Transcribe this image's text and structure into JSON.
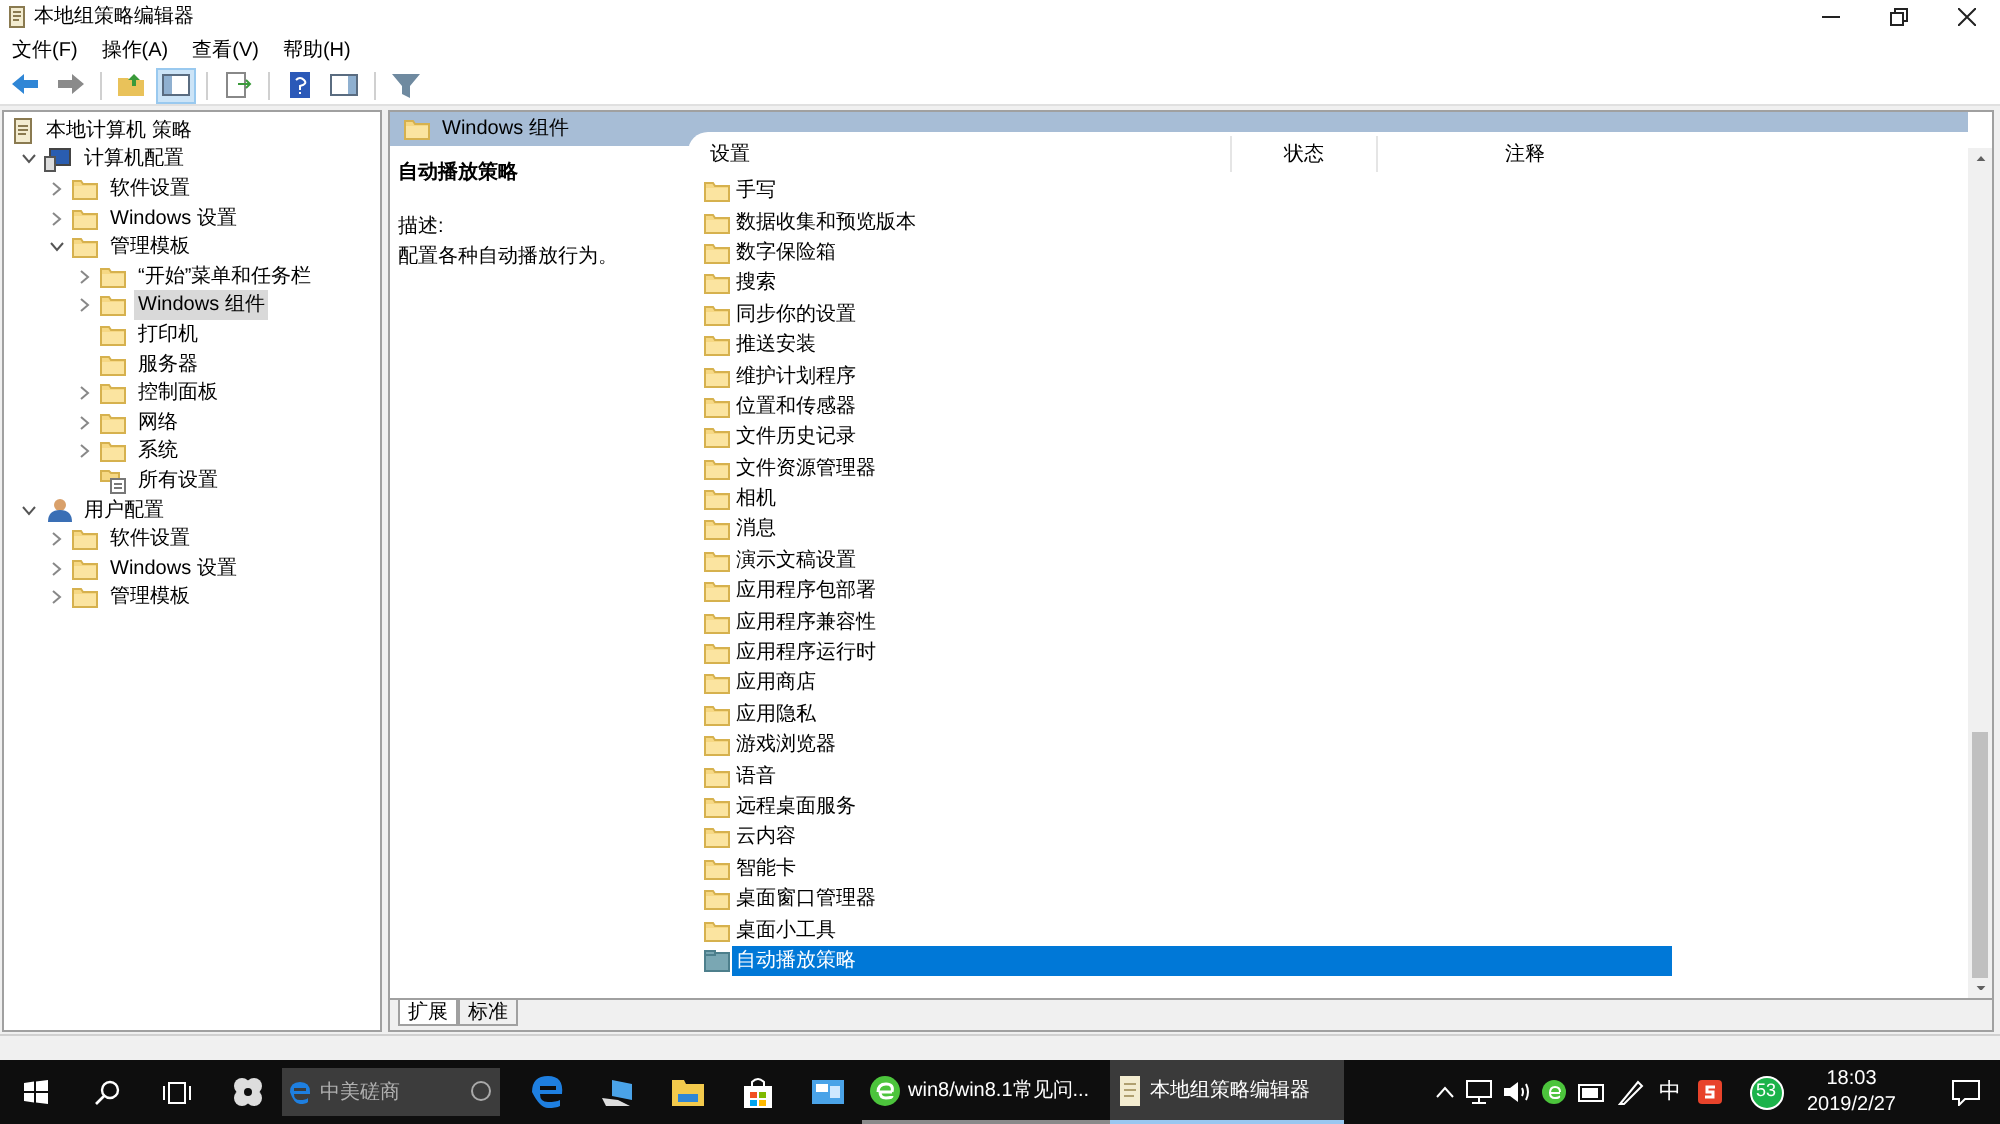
{
  "window": {
    "title": "本地组策略编辑器"
  },
  "menu": [
    "文件(F)",
    "操作(A)",
    "查看(V)",
    "帮助(H)"
  ],
  "toolbar": [
    {
      "kind": "back",
      "on": false
    },
    {
      "kind": "forward",
      "on": false
    },
    {
      "kind": "sep"
    },
    {
      "kind": "up",
      "on": false
    },
    {
      "kind": "tree",
      "on": true
    },
    {
      "kind": "sep"
    },
    {
      "kind": "export",
      "on": false
    },
    {
      "kind": "sep"
    },
    {
      "kind": "help",
      "on": false
    },
    {
      "kind": "pane",
      "on": false
    },
    {
      "kind": "sep"
    },
    {
      "kind": "filter",
      "on": false
    }
  ],
  "tree": [
    {
      "label": "本地计算机 策略",
      "kind": "policy",
      "selected": false,
      "children": [
        {
          "label": "计算机配置",
          "kind": "computer",
          "expanded": true,
          "selected": false,
          "children": [
            {
              "label": "软件设置",
              "kind": "folder",
              "expanded": false,
              "selected": false
            },
            {
              "label": "Windows 设置",
              "kind": "folder",
              "expanded": false,
              "selected": false
            },
            {
              "label": "管理模板",
              "kind": "folder",
              "expanded": true,
              "selected": false,
              "children": [
                {
                  "label": "“开始”菜单和任务栏",
                  "kind": "folder",
                  "expanded": false,
                  "selected": false
                },
                {
                  "label": "Windows 组件",
                  "kind": "folder",
                  "expanded": false,
                  "selected": true
                },
                {
                  "label": "打印机",
                  "kind": "folder",
                  "selected": false
                },
                {
                  "label": "服务器",
                  "kind": "folder",
                  "selected": false
                },
                {
                  "label": "控制面板",
                  "kind": "folder",
                  "expanded": false,
                  "selected": false
                },
                {
                  "label": "网络",
                  "kind": "folder",
                  "expanded": false,
                  "selected": false
                },
                {
                  "label": "系统",
                  "kind": "folder",
                  "expanded": false,
                  "selected": false
                },
                {
                  "label": "所有设置",
                  "kind": "settings",
                  "selected": false
                }
              ]
            }
          ]
        },
        {
          "label": "用户配置",
          "kind": "user",
          "expanded": true,
          "selected": false,
          "children": [
            {
              "label": "软件设置",
              "kind": "folder",
              "expanded": false,
              "selected": false
            },
            {
              "label": "Windows 设置",
              "kind": "folder",
              "expanded": false,
              "selected": false
            },
            {
              "label": "管理模板",
              "kind": "folder",
              "expanded": false,
              "selected": false
            }
          ]
        }
      ]
    }
  ],
  "pane_header": "Windows 组件",
  "description": {
    "title": "自动播放策略",
    "label": "描述:",
    "text": "配置各种自动播放行为。"
  },
  "columns": [
    "设置",
    "状态",
    "注释"
  ],
  "items": [
    {
      "label": "手写",
      "kind": "folder",
      "selected": false
    },
    {
      "label": "数据收集和预览版本",
      "kind": "folder",
      "selected": false
    },
    {
      "label": "数字保险箱",
      "kind": "folder",
      "selected": false
    },
    {
      "label": "搜索",
      "kind": "folder",
      "selected": false
    },
    {
      "label": "同步你的设置",
      "kind": "folder",
      "selected": false
    },
    {
      "label": "推送安装",
      "kind": "folder",
      "selected": false
    },
    {
      "label": "维护计划程序",
      "kind": "folder",
      "selected": false
    },
    {
      "label": "位置和传感器",
      "kind": "folder",
      "selected": false
    },
    {
      "label": "文件历史记录",
      "kind": "folder",
      "selected": false
    },
    {
      "label": "文件资源管理器",
      "kind": "folder",
      "selected": false
    },
    {
      "label": "相机",
      "kind": "folder",
      "selected": false
    },
    {
      "label": "消息",
      "kind": "folder",
      "selected": false
    },
    {
      "label": "演示文稿设置",
      "kind": "folder",
      "selected": false
    },
    {
      "label": "应用程序包部署",
      "kind": "folder",
      "selected": false
    },
    {
      "label": "应用程序兼容性",
      "kind": "folder",
      "selected": false
    },
    {
      "label": "应用程序运行时",
      "kind": "folder",
      "selected": false
    },
    {
      "label": "应用商店",
      "kind": "folder",
      "selected": false
    },
    {
      "label": "应用隐私",
      "kind": "folder",
      "selected": false
    },
    {
      "label": "游戏浏览器",
      "kind": "folder",
      "selected": false
    },
    {
      "label": "语音",
      "kind": "folder",
      "selected": false
    },
    {
      "label": "远程桌面服务",
      "kind": "folder",
      "selected": false
    },
    {
      "label": "云内容",
      "kind": "folder",
      "selected": false
    },
    {
      "label": "智能卡",
      "kind": "folder",
      "selected": false
    },
    {
      "label": "桌面窗口管理器",
      "kind": "folder",
      "selected": false
    },
    {
      "label": "桌面小工具",
      "kind": "folder",
      "selected": false
    },
    {
      "label": "自动播放策略",
      "kind": "policy-folder",
      "selected": true
    }
  ],
  "bottom_tabs": [
    {
      "label": "扩展",
      "selected": true
    },
    {
      "label": "标准",
      "selected": false
    }
  ],
  "taskbar": {
    "search": {
      "placeholder": "中美磋商"
    },
    "tasks": [
      {
        "label": "win8/win8.1常见问...",
        "kind": "browser",
        "selected": false
      },
      {
        "label": "本地组策略编辑器",
        "kind": "editor",
        "selected": true
      }
    ],
    "ime": "中",
    "badge": "53",
    "time": "18:03",
    "date": "2019/2/27"
  }
}
